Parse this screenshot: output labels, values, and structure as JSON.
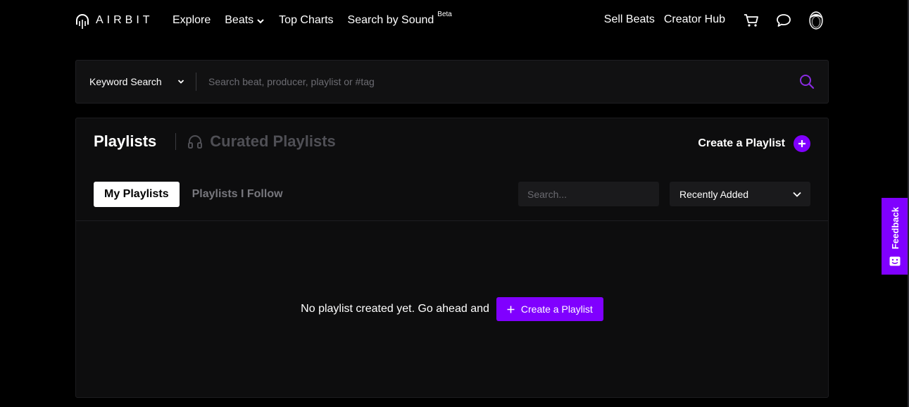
{
  "brand": {
    "name": "AIRBIT",
    "accent": "#8000ff"
  },
  "nav": {
    "explore": "Explore",
    "beats": "Beats",
    "top_charts": "Top Charts",
    "search_by_sound": "Search by Sound",
    "beta": "Beta",
    "sell_beats": "Sell Beats",
    "creator_hub": "Creator Hub"
  },
  "search": {
    "mode": "Keyword Search",
    "placeholder": "Search beat, producer, playlist or #tag"
  },
  "panel": {
    "title": "Playlists",
    "curated": "Curated Playlists",
    "create_label": "Create a Playlist",
    "tabs": {
      "my": "My Playlists",
      "following": "Playlists I Follow"
    },
    "filter_placeholder": "Search...",
    "sort_value": "Recently Added",
    "empty_text": "No playlist created yet. Go ahead and",
    "empty_button": "Create a Playlist"
  },
  "feedback": {
    "label": "Feedback"
  }
}
